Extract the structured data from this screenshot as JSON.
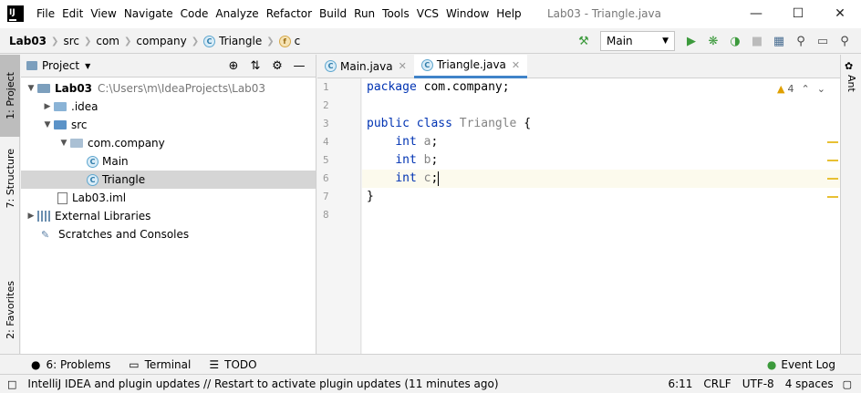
{
  "titlebar": {
    "menu": [
      "File",
      "Edit",
      "View",
      "Navigate",
      "Code",
      "Analyze",
      "Refactor",
      "Build",
      "Run",
      "Tools",
      "VCS",
      "Window",
      "Help"
    ],
    "title": "Lab03 - Triangle.java"
  },
  "navbar": {
    "crumbs": [
      "Lab03",
      "src",
      "com",
      "company",
      "Triangle",
      "c"
    ],
    "run_config": "Main"
  },
  "left_strip": {
    "project_tab": "1: Project",
    "structure_tab": "7: Structure",
    "favorites_tab": "2: Favorites"
  },
  "right_strip": {
    "ant_tab": "Ant"
  },
  "project": {
    "title": "Project",
    "root_name": "Lab03",
    "root_path": "C:\\Users\\m\\IdeaProjects\\Lab03",
    "idea": ".idea",
    "src": "src",
    "package": "com.company",
    "main": "Main",
    "triangle": "Triangle",
    "iml": "Lab03.iml",
    "external": "External Libraries",
    "scratches": "Scratches and Consoles"
  },
  "editor": {
    "tabs": [
      "Main.java",
      "Triangle.java"
    ],
    "line_numbers": [
      "1",
      "2",
      "3",
      "4",
      "5",
      "6",
      "7",
      "8"
    ],
    "warning_count": "4",
    "code": {
      "l1_kw": "package",
      "l1_rest": " com.company;",
      "l3_kw1": "public",
      "l3_kw2": "class",
      "l3_name": "Triangle",
      "l3_rest": " {",
      "type": "int",
      "a": "a",
      "b": "b",
      "c": "c",
      "semi": ";",
      "close": "}"
    }
  },
  "bottom_tools": {
    "problems": "6: Problems",
    "terminal": "Terminal",
    "todo": "TODO",
    "event_log": "Event Log"
  },
  "status": {
    "message": "IntelliJ IDEA and plugin updates // Restart to activate plugin updates (11 minutes ago)",
    "position": "6:11",
    "line_sep": "CRLF",
    "encoding": "UTF-8",
    "indent": "4 spaces"
  }
}
